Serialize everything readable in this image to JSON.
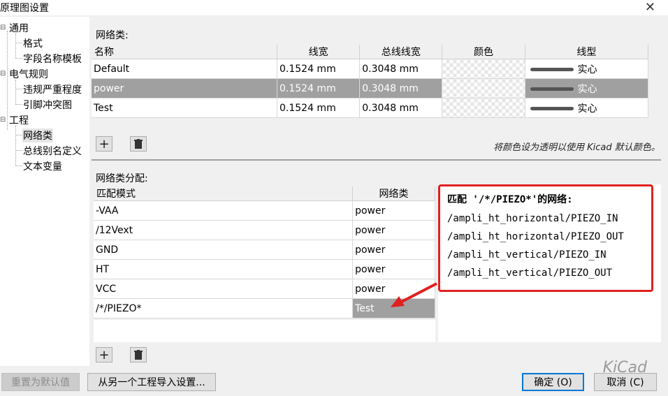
{
  "window": {
    "title": "原理图设置",
    "close": "✕"
  },
  "tree": {
    "items": [
      {
        "label": "通用"
      },
      {
        "label": "格式"
      },
      {
        "label": "字段名称模板"
      },
      {
        "label": "电气规则"
      },
      {
        "label": "违规严重程度"
      },
      {
        "label": "引脚冲突图"
      },
      {
        "label": "工程"
      },
      {
        "label": "网络类"
      },
      {
        "label": "总线别名定义"
      },
      {
        "label": "文本变量"
      }
    ]
  },
  "netclasses": {
    "section_title": "网络类:",
    "headers": [
      "名称",
      "线宽",
      "总线线宽",
      "颜色",
      "线型"
    ],
    "rows": [
      {
        "name": "Default",
        "wire": "0.1524 mm",
        "bus": "0.3048 mm",
        "style": "实心"
      },
      {
        "name": "power",
        "wire": "0.1524 mm",
        "bus": "0.3048 mm",
        "style": "实心"
      },
      {
        "name": "Test",
        "wire": "0.1524 mm",
        "bus": "0.3048 mm",
        "style": "实心"
      }
    ],
    "hint": "将颜色设为透明以使用 Kicad 默认颜色。"
  },
  "assignments": {
    "section_title": "网络类分配:",
    "headers": [
      "匹配模式",
      "网络类"
    ],
    "rows": [
      {
        "pattern": "-VAA",
        "netclass": "power"
      },
      {
        "pattern": "/12Vext",
        "netclass": "power"
      },
      {
        "pattern": "GND",
        "netclass": "power"
      },
      {
        "pattern": "HT",
        "netclass": "power"
      },
      {
        "pattern": "VCC",
        "netclass": "power"
      },
      {
        "pattern": "/*/PIEZO*",
        "netclass": "Test"
      }
    ]
  },
  "callout": {
    "title": "匹配 '/*/PIEZO*'的网络:",
    "lines": [
      "/ampli_ht_horizontal/PIEZO_IN",
      "/ampli_ht_horizontal/PIEZO_OUT",
      "/ampli_ht_vertical/PIEZO_IN",
      "/ampli_ht_vertical/PIEZO_OUT"
    ]
  },
  "buttons": {
    "reset": "重置为默认值",
    "import": "从另一个工程导入设置...",
    "ok": "确定 (O)",
    "cancel": "取消 (C)"
  },
  "watermark": "KiCad",
  "colors": {
    "selected_row": "#a0a0a0",
    "callout_border": "#e02020",
    "accent": "#0078d7"
  }
}
